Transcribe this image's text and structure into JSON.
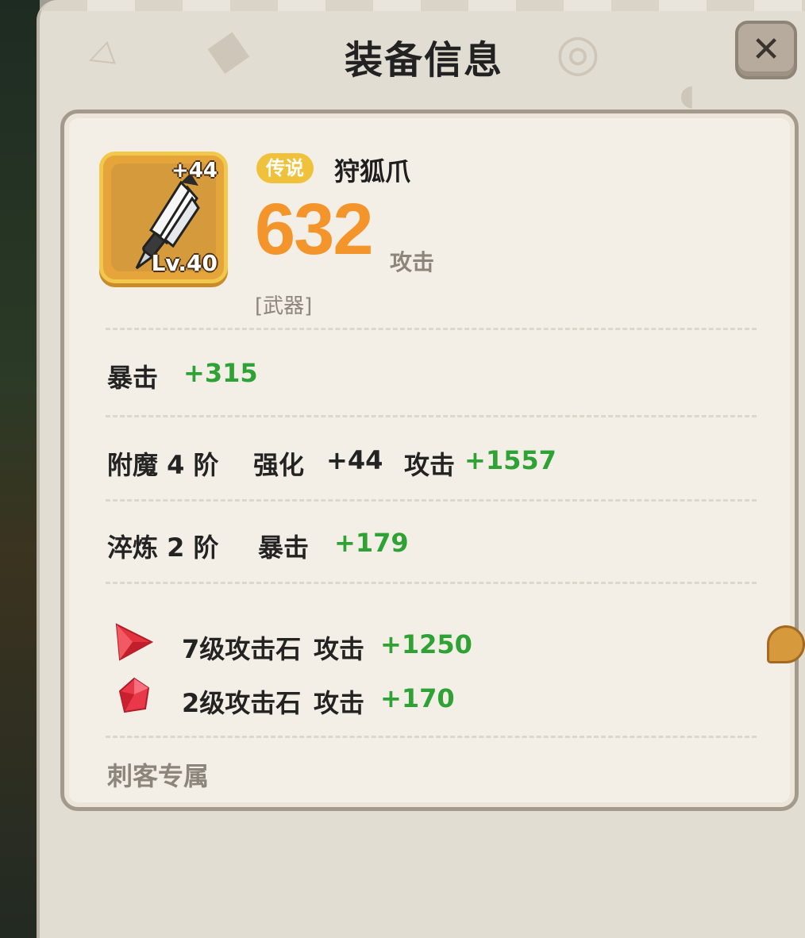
{
  "modal": {
    "title": "装备信息",
    "close_label": "✕"
  },
  "item": {
    "rarity": "传说",
    "name": "狩狐爪",
    "enhance_badge": "+44",
    "level_badge": "Lv.40",
    "main_value": "632",
    "main_label": "攻击",
    "type": "[武器]"
  },
  "stats": {
    "crit": {
      "label": "暴击",
      "value": "+315"
    },
    "enchant": {
      "tier_label": "附魔 4 阶",
      "enhance_label": "强化",
      "enhance_value": "+44",
      "attack_label": "攻击",
      "attack_value": "+1557"
    },
    "temper": {
      "tier_label": "淬炼 2 阶",
      "crit_label": "暴击",
      "crit_value": "+179"
    }
  },
  "gems": [
    {
      "name": "7级攻击石",
      "stat": "攻击",
      "value": "+1250",
      "icon": "red-gem-icon"
    },
    {
      "name": "2级攻击石",
      "stat": "攻击",
      "value": "+170",
      "icon": "red-gem-icon"
    }
  ],
  "class_restriction": "刺客专属",
  "colors": {
    "accent_orange": "#f3952b",
    "bonus_green": "#2fa236",
    "legend_gold": "#f0c23b"
  }
}
